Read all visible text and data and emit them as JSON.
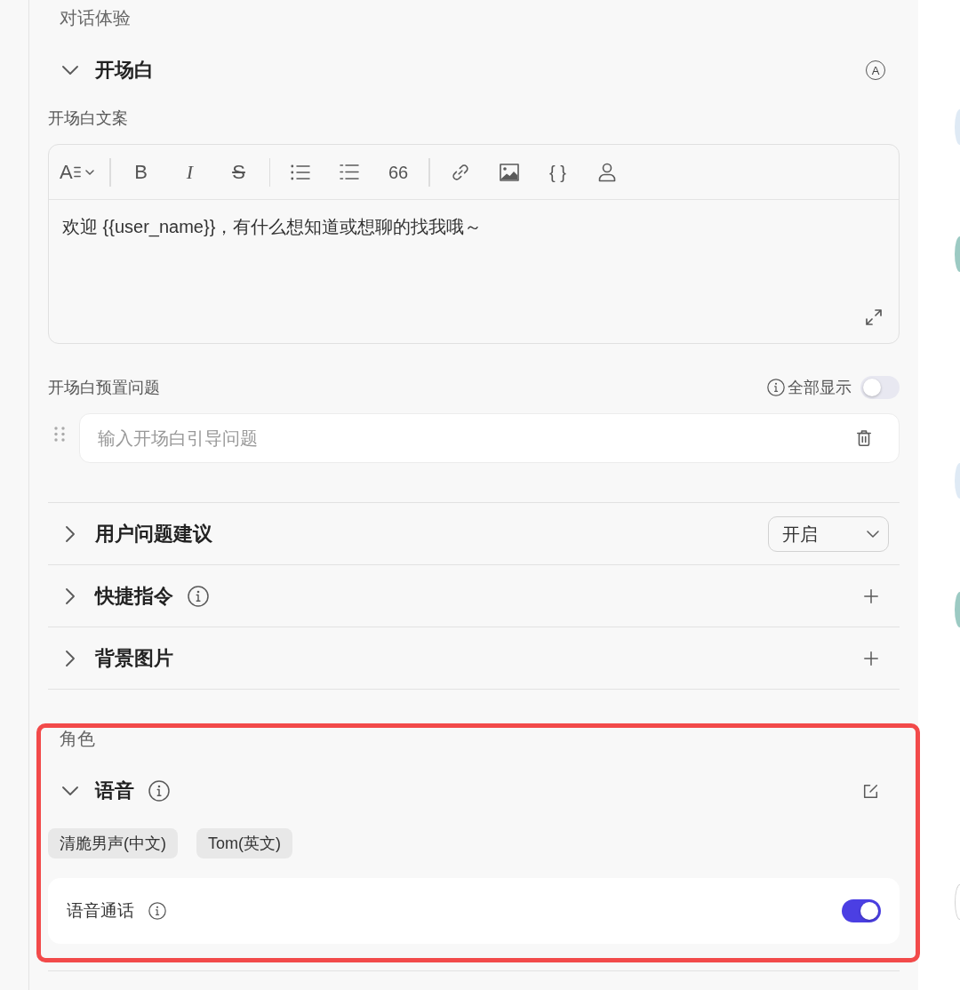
{
  "sections": [
    {
      "title": "对话体验",
      "highlighted": false,
      "groups": [
        {
          "title": "开场白",
          "expanded": true,
          "info": false,
          "action": {
            "kind": "mode",
            "glyph": "A"
          },
          "copy": {
            "label": "开场白文案",
            "toolbar": [
              {
                "kind": "font",
                "glyph": "A"
              },
              {
                "kind": "sep"
              },
              {
                "kind": "bold",
                "glyph": "B"
              },
              {
                "kind": "italic",
                "glyph": "I"
              },
              {
                "kind": "strike",
                "glyph": "S"
              },
              {
                "kind": "sep"
              },
              {
                "kind": "bullets"
              },
              {
                "kind": "numbers"
              },
              {
                "kind": "quote",
                "glyph": "66"
              },
              {
                "kind": "sep"
              },
              {
                "kind": "link"
              },
              {
                "kind": "image"
              },
              {
                "kind": "variable",
                "glyph": "{ }"
              },
              {
                "kind": "person"
              }
            ],
            "text": "欢迎 {{user_name}}，有什么想知道或想聊的找我哦～"
          },
          "presets": {
            "label": "开场白预置问题",
            "show_all": {
              "label": "全部显示",
              "on": false
            },
            "questions": [
              {
                "placeholder": "输入开场白引导问题"
              }
            ]
          }
        },
        {
          "title": "用户问题建议",
          "expanded": false,
          "info": false,
          "action": {
            "kind": "select",
            "value": "开启"
          }
        },
        {
          "title": "快捷指令",
          "expanded": false,
          "info": true,
          "action": {
            "kind": "add"
          }
        },
        {
          "title": "背景图片",
          "expanded": false,
          "info": false,
          "action": {
            "kind": "add"
          }
        }
      ]
    },
    {
      "title": "角色",
      "highlighted": true,
      "groups": [
        {
          "title": "语音",
          "expanded": true,
          "info": true,
          "action": {
            "kind": "edit"
          },
          "voices": [
            "清脆男声(中文)",
            "Tom(英文)"
          ],
          "call": {
            "label": "语音通话",
            "info": true,
            "on": true
          }
        }
      ]
    }
  ],
  "edge": [
    {
      "kind": "disc",
      "color": "#dfeaf5"
    },
    {
      "kind": "disc",
      "color": "#9ccac3"
    },
    {
      "kind": "disc",
      "color": "#dfeaf5"
    },
    {
      "kind": "disc",
      "color": "#9ccac3"
    },
    {
      "kind": "ring",
      "color": "#d2d2d2"
    }
  ]
}
